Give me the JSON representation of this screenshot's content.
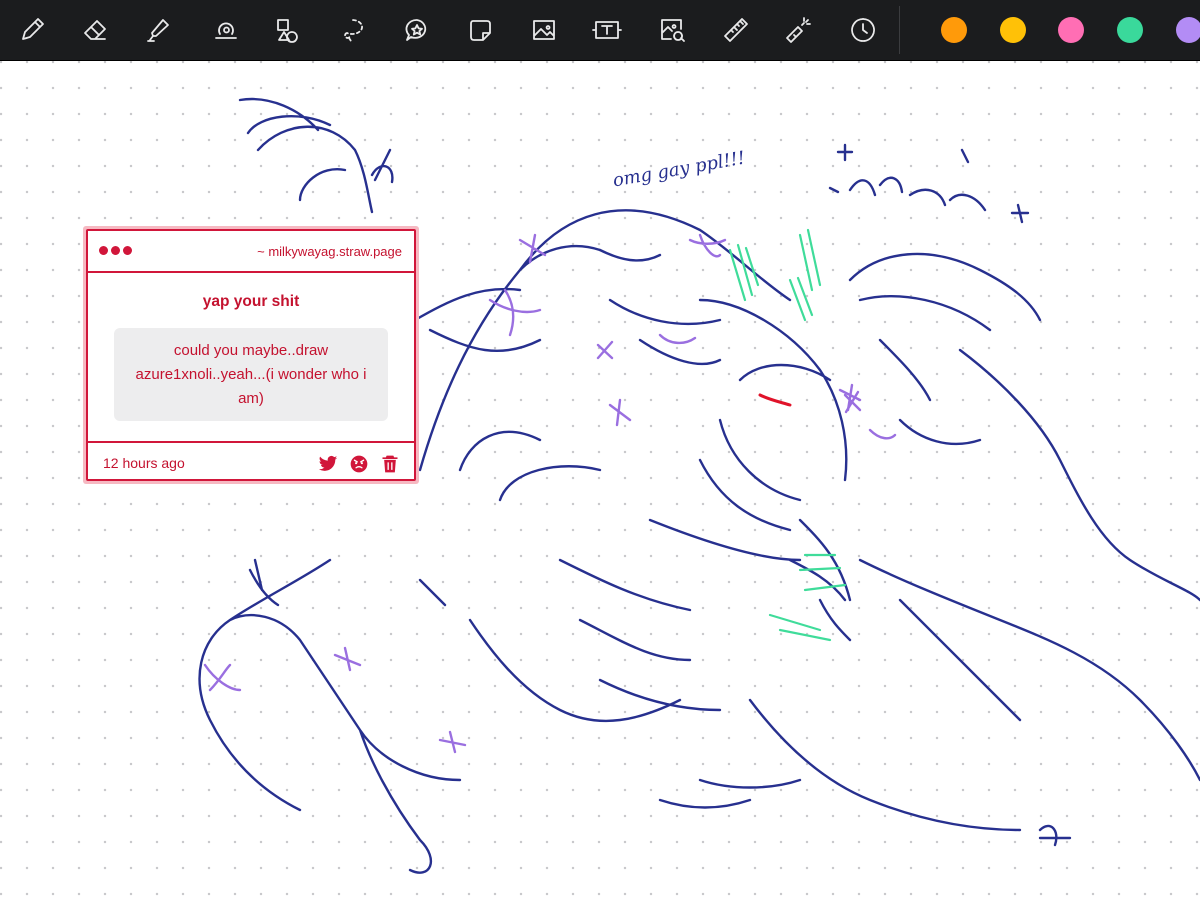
{
  "toolbar": {
    "tools": [
      {
        "name": "pen",
        "icon": "pen-icon"
      },
      {
        "name": "eraser",
        "icon": "eraser-icon"
      },
      {
        "name": "highlighter",
        "icon": "highlighter-icon"
      },
      {
        "name": "shape",
        "icon": "shape-icon"
      },
      {
        "name": "shapes",
        "icon": "shapes-icon"
      },
      {
        "name": "lasso",
        "icon": "lasso-icon"
      },
      {
        "name": "sticker",
        "icon": "sticker-icon"
      },
      {
        "name": "note",
        "icon": "sticky-note-icon"
      },
      {
        "name": "image",
        "icon": "image-icon"
      },
      {
        "name": "text",
        "icon": "text-icon"
      },
      {
        "name": "image-zoom",
        "icon": "image-zoom-icon"
      },
      {
        "name": "ruler",
        "icon": "ruler-icon"
      },
      {
        "name": "laser",
        "icon": "laser-pointer-icon"
      },
      {
        "name": "history",
        "icon": "clock-icon"
      }
    ],
    "colors": [
      "#ff9a0a",
      "#ffc107",
      "#ff6eb4",
      "#3ad99b",
      "#b38cf5"
    ]
  },
  "canvas": {
    "handwriting": "omg gay ppl!!!"
  },
  "card": {
    "url": "~ milkywayag.straw.page",
    "title": "yap your shit",
    "message": "could you maybe..draw azure1xnoli..yeah...(i wonder who i am)",
    "time": "12 hours ago",
    "icons": [
      "twitter-icon",
      "angry-face-icon",
      "trash-icon"
    ],
    "accent": "#d1163a"
  }
}
